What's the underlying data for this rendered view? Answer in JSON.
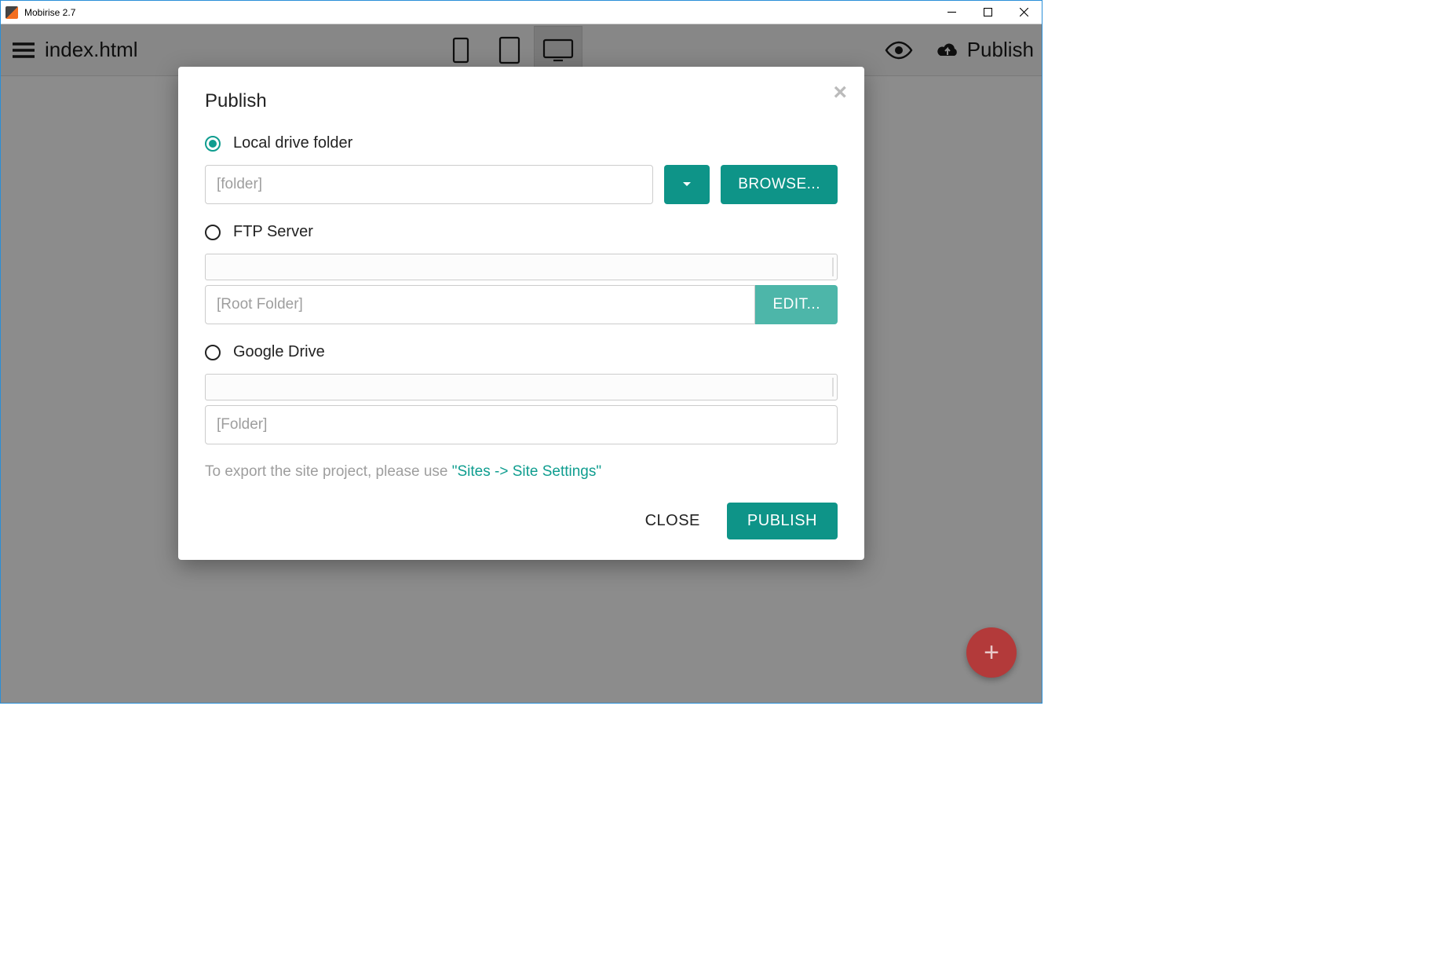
{
  "title_bar": {
    "app_title": "Mobirise 2.7"
  },
  "toolbar": {
    "page_title": "index.html",
    "publish_label": "Publish"
  },
  "modal": {
    "title": "Publish",
    "options": {
      "local": {
        "label": "Local drive folder",
        "placeholder": "[folder]",
        "browse_label": "BROWSE..."
      },
      "ftp": {
        "label": "FTP Server",
        "placeholder": "[Root Folder]",
        "edit_label": "EDIT..."
      },
      "gdrive": {
        "label": "Google Drive",
        "placeholder": "[Folder]"
      }
    },
    "hint_prefix": "To export the site project, please use ",
    "hint_link": "\"Sites -> Site Settings\"",
    "footer": {
      "close_label": "CLOSE",
      "publish_label": "PUBLISH"
    }
  }
}
